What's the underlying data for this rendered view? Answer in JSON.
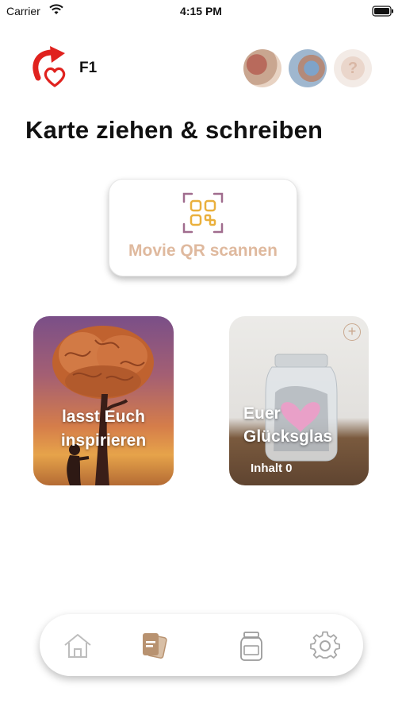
{
  "status_bar": {
    "carrier": "Carrier",
    "time": "4:15 PM"
  },
  "header": {
    "profile_label": "F1"
  },
  "page": {
    "title": "Karte ziehen & schreiben"
  },
  "qr_button": {
    "label": "Movie QR scannen"
  },
  "cards": {
    "inspire": {
      "label_line1": "lasst Euch",
      "label_line2": "inspirieren"
    },
    "jar": {
      "label_line1": "Euer",
      "label_line2": "Glücksglas",
      "content": "Inhalt 0"
    }
  },
  "help": {
    "symbol": "?"
  },
  "icons": {
    "logo": "heart-arrow-logo-icon",
    "qr": "qr-code-icon",
    "home": "home-icon",
    "cards": "cards-icon",
    "jar": "jar-icon",
    "settings": "gear-icon",
    "add": "plus-circle-icon"
  },
  "colors": {
    "accent": "#dfb99e",
    "active_tab": "#b89270",
    "logo_red": "#e0221e"
  }
}
